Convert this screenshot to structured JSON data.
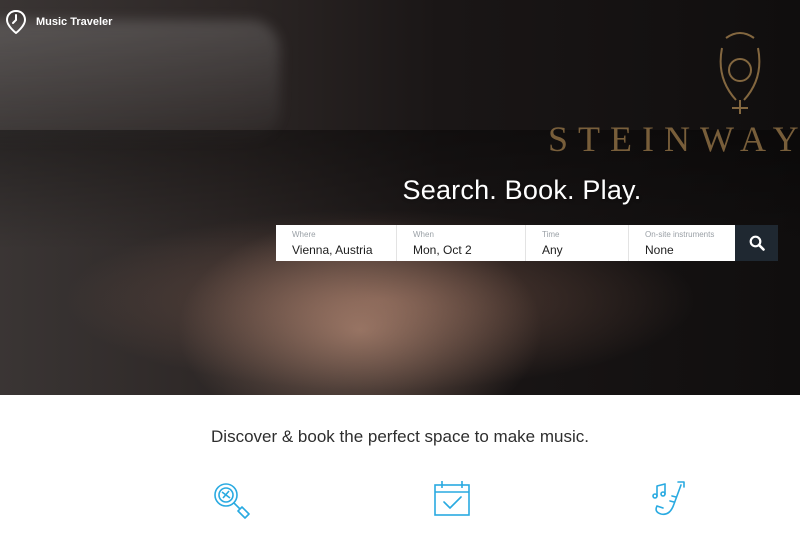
{
  "brand": {
    "name": "Music Traveler",
    "logo_icon": "pin-clock-icon"
  },
  "hero": {
    "tagline": "Search. Book. Play.",
    "photo_text": "STEINWAY &"
  },
  "search": {
    "where": {
      "label": "Where",
      "value": "Vienna, Austria"
    },
    "when": {
      "label": "When",
      "value": "Mon, Oct 2"
    },
    "time": {
      "label": "Time",
      "value": "Any"
    },
    "instruments": {
      "label": "On-site instruments",
      "value": "None"
    },
    "button_icon": "search-icon"
  },
  "discover": {
    "title": "Discover & book the perfect space to make music.",
    "features": [
      {
        "icon": "magnifier-search-icon"
      },
      {
        "icon": "calendar-check-icon"
      },
      {
        "icon": "saxophone-music-icon"
      }
    ]
  },
  "colors": {
    "accent": "#29aae1",
    "search_button": "#1f2831"
  }
}
